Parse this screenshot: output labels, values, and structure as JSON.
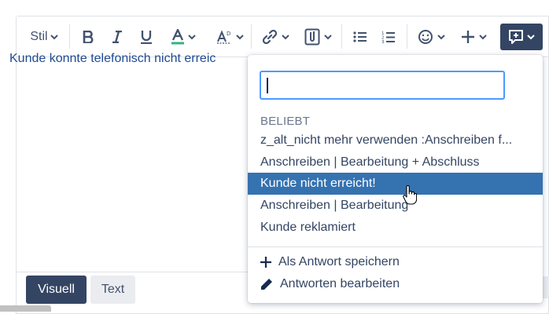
{
  "toolbar": {
    "style_label": "Stil",
    "icons": [
      "bold-icon",
      "italic-icon",
      "underline-icon",
      "text-color-icon",
      "clear-format-icon",
      "link-icon",
      "attachment-icon",
      "bullet-list-icon",
      "numbered-list-icon",
      "emoji-icon",
      "insert-plus-icon",
      "macro-icon"
    ],
    "text_color": "#36b37e",
    "macro_button_color": "#344563"
  },
  "editor": {
    "content": "Kunde konnte telefonisch nicht erreic"
  },
  "mode_buttons": {
    "visual": "Visuell",
    "text": "Text"
  },
  "dropdown": {
    "search_value": "",
    "section_title": "BELIEBT",
    "items": [
      {
        "label": "z_alt_nicht mehr verwenden :Anschreiben f..."
      },
      {
        "label": "Anschreiben | Bearbeitung + Abschluss"
      },
      {
        "label": "Kunde nicht erreicht!"
      },
      {
        "label": "Anschreiben | Bearbeitung"
      },
      {
        "label": "Kunde reklamiert"
      }
    ],
    "active_index": 2,
    "active_color": "#3572b0",
    "actions": {
      "save": "Als Antwort speichern",
      "edit": "Antworten bearbeiten"
    }
  }
}
